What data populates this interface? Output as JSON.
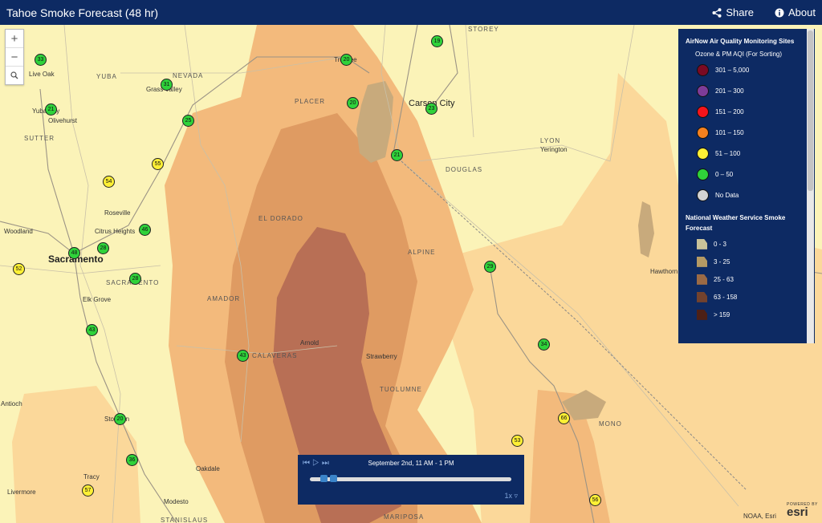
{
  "header": {
    "title": "Tahoe Smoke Forecast (48 hr)",
    "share_label": "Share",
    "about_label": "About"
  },
  "zoom": {
    "in": "+",
    "out": "−"
  },
  "colors": {
    "header_bg": "#0d2a63",
    "map_base": "#fbf3b8",
    "smoke_light": "#fbd89a",
    "smoke_mid": "#f3ba7c",
    "smoke_dark": "#df9b62",
    "smoke_darkest": "#b86f55",
    "lake": "#c8aa7c"
  },
  "map_labels": {
    "storey": "STOREY",
    "truckee": "Truckee",
    "nevada": "NEVADA",
    "yuba": "YUBA",
    "live_oak": "Live Oak",
    "grass_valley": "Grass Valley",
    "placer": "PLACER",
    "carson_city": "Carson City",
    "yuba_city": "Yuba City",
    "olivehurst": "Olivehurst",
    "sutter": "SUTTER",
    "lyon": "LYON",
    "yerington": "Yerington",
    "douglas": "DOUGLAS",
    "roseville": "Roseville",
    "el_dorado": "EL DORADO",
    "woodland": "Woodland",
    "citrus_heights": "Citrus Heights",
    "sacramento": "Sacramento",
    "sacramento_county": "SACRAMENTO",
    "alpine": "ALPINE",
    "hawthorne": "Hawthorn",
    "elk_grove": "Elk Grove",
    "amador": "AMADOR",
    "arnold": "Arnold",
    "calaveras": "CALAVERAS",
    "strawberry": "Strawberry",
    "tuolumne": "TUOLUMNE",
    "antioch": "Antioch",
    "stockton": "Stockton",
    "mono": "MONO",
    "oakdale": "Oakdale",
    "tracy": "Tracy",
    "livermore": "Livermore",
    "modesto": "Modesto",
    "mariposa": "MARIPOSA",
    "stanislaus": "STANISLAUS"
  },
  "aqi_markers": [
    {
      "value": "19",
      "level": "good"
    },
    {
      "value": "33",
      "level": "good"
    },
    {
      "value": "31",
      "level": "good"
    },
    {
      "value": "20",
      "level": "good"
    },
    {
      "value": "23",
      "level": "good"
    },
    {
      "value": "21",
      "level": "good"
    },
    {
      "value": "25",
      "level": "good"
    },
    {
      "value": "20",
      "level": "good"
    },
    {
      "value": "55",
      "level": "moderate"
    },
    {
      "value": "54",
      "level": "moderate"
    },
    {
      "value": "46",
      "level": "good"
    },
    {
      "value": "28",
      "level": "good"
    },
    {
      "value": "48",
      "level": "good"
    },
    {
      "value": "52",
      "level": "moderate"
    },
    {
      "value": "29",
      "level": "good"
    },
    {
      "value": "28",
      "level": "good"
    },
    {
      "value": "43",
      "level": "good"
    },
    {
      "value": "43",
      "level": "good"
    },
    {
      "value": "34",
      "level": "good"
    },
    {
      "value": "21",
      "level": "good"
    },
    {
      "value": "66",
      "level": "moderate"
    },
    {
      "value": "53",
      "level": "moderate"
    },
    {
      "value": "36",
      "level": "good"
    },
    {
      "value": "57",
      "level": "moderate"
    },
    {
      "value": "20",
      "level": "good"
    },
    {
      "value": "56",
      "level": "moderate"
    }
  ],
  "legend": {
    "airnow_title": "AirNow Air Quality Monitoring Sites",
    "airnow_subtitle": "Ozone & PM AQI (For Sorting)",
    "aqi_classes": [
      {
        "label": "301 – 5,000",
        "color": "#7a0a24"
      },
      {
        "label": "201 – 300",
        "color": "#7d3c98"
      },
      {
        "label": "151 – 200",
        "color": "#f5141b"
      },
      {
        "label": "101 – 150",
        "color": "#f5811f"
      },
      {
        "label": "51 – 100",
        "color": "#fef035"
      },
      {
        "label": "0 – 50",
        "color": "#2fd23a"
      },
      {
        "label": "No Data",
        "color": "#d3d3d3"
      }
    ],
    "nws_title": "National Weather Service Smoke Forecast",
    "smoke_classes": [
      {
        "label": "0 - 3",
        "color": "#c8c29a"
      },
      {
        "label": "3 - 25",
        "color": "#b59a64"
      },
      {
        "label": "25 - 63",
        "color": "#9b6a45"
      },
      {
        "label": "63 - 158",
        "color": "#73422d"
      },
      {
        "label": "> 159",
        "color": "#4d2016"
      }
    ]
  },
  "timeline": {
    "label": "September 2nd, 11 AM - 1 PM",
    "speed": "1x",
    "position": 0.08
  },
  "attribution": {
    "source": "NOAA, Esri",
    "powered": "POWERED BY",
    "brand": "esri"
  }
}
